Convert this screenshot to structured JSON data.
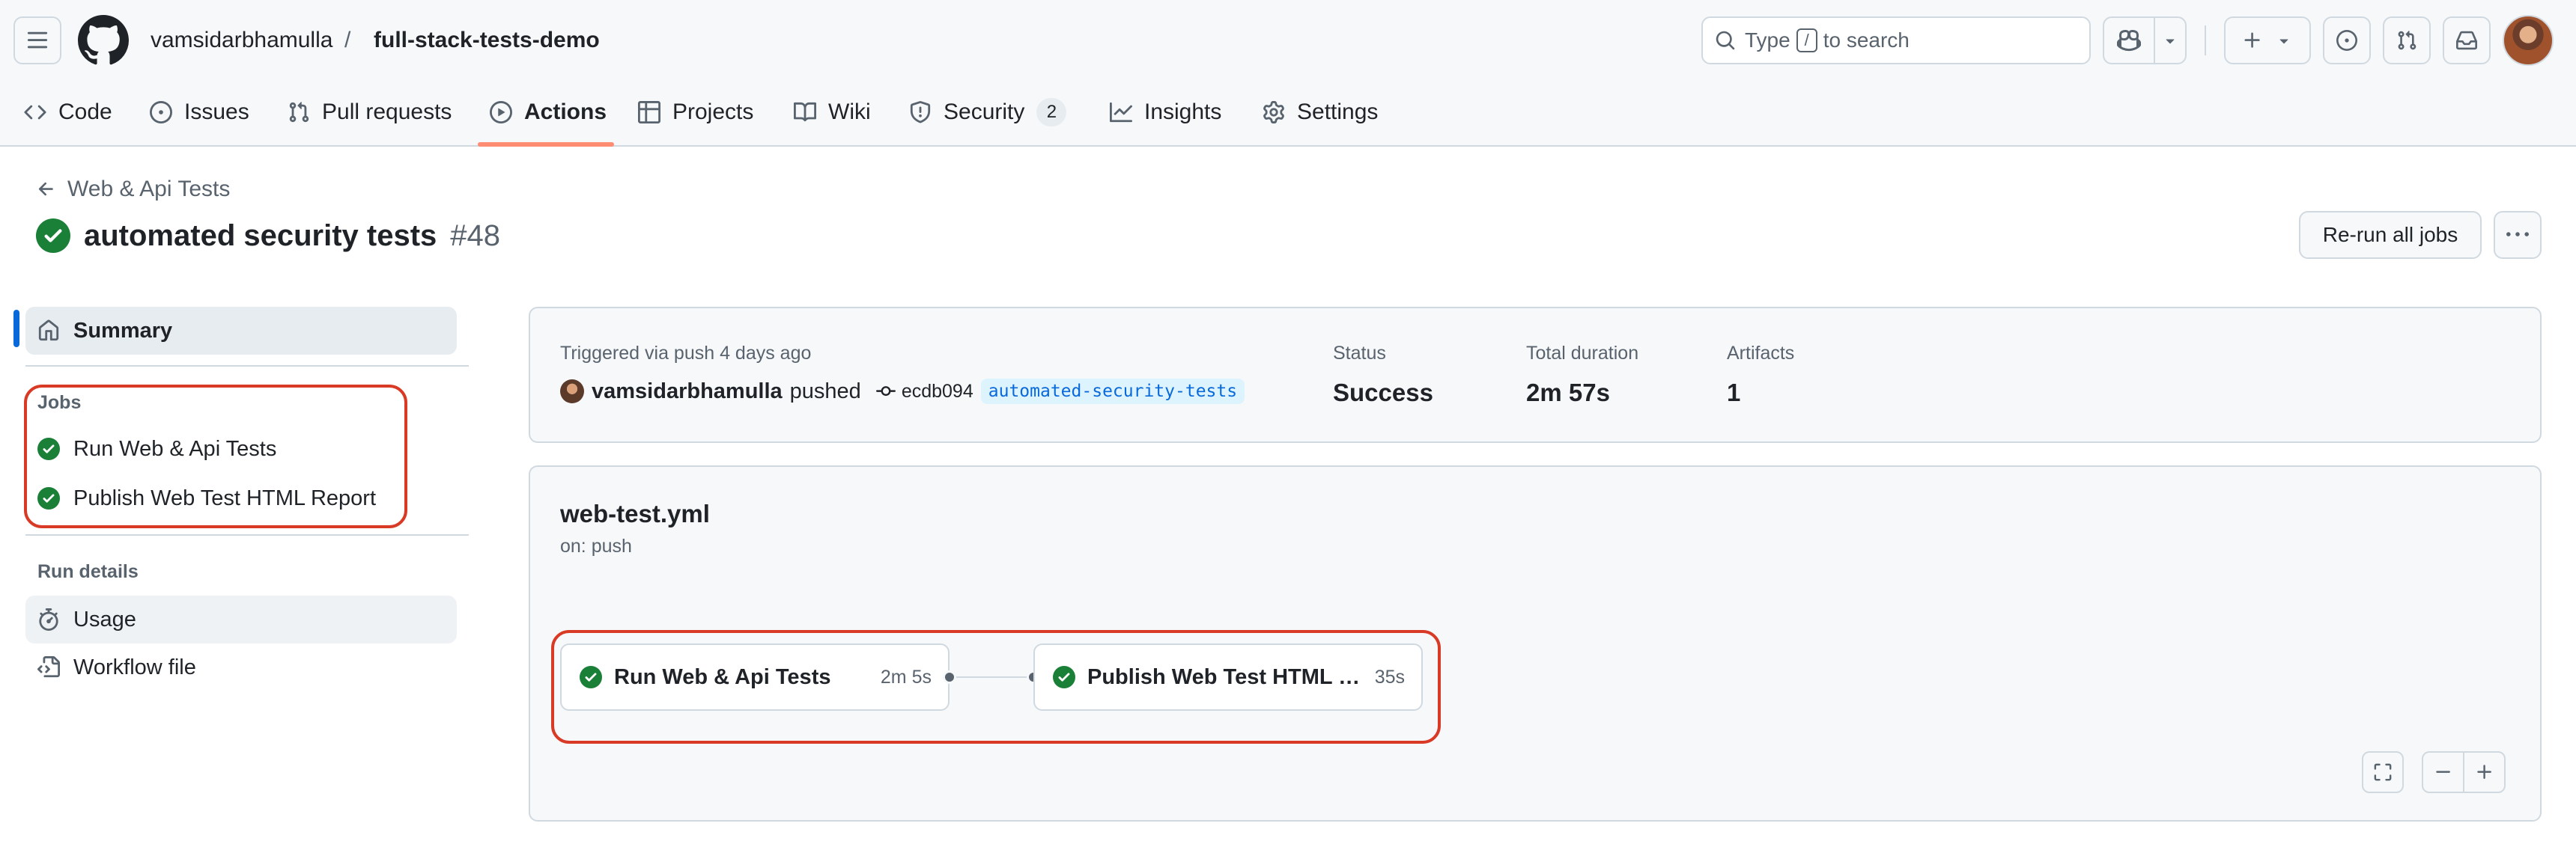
{
  "header": {
    "owner": "vamsidarbhamulla",
    "separator": "/",
    "repo": "full-stack-tests-demo",
    "search_prefix": "Type",
    "search_key": "/",
    "search_suffix": "to search"
  },
  "tabs": [
    {
      "label": "Code",
      "icon": "code-icon"
    },
    {
      "label": "Issues",
      "icon": "issue-opened-icon"
    },
    {
      "label": "Pull requests",
      "icon": "git-pull-request-icon"
    },
    {
      "label": "Actions",
      "icon": "play-icon",
      "active": true
    },
    {
      "label": "Projects",
      "icon": "table-icon"
    },
    {
      "label": "Wiki",
      "icon": "book-icon"
    },
    {
      "label": "Security",
      "icon": "shield-icon",
      "counter": "2"
    },
    {
      "label": "Insights",
      "icon": "graph-icon"
    },
    {
      "label": "Settings",
      "icon": "gear-icon"
    }
  ],
  "run": {
    "back_label": "Web & Api Tests",
    "title": "automated security tests",
    "number": "#48",
    "rerun_label": "Re-run all jobs"
  },
  "sidebar": {
    "summary_label": "Summary",
    "jobs_heading": "Jobs",
    "jobs": [
      "Run Web & Api Tests",
      "Publish Web Test HTML Report"
    ],
    "run_details_heading": "Run details",
    "usage_label": "Usage",
    "workflow_file_label": "Workflow file"
  },
  "summary": {
    "trigger_text": "Triggered via push 4 days ago",
    "actor": "vamsidarbhamulla",
    "action": "pushed",
    "commit": "ecdb094",
    "branch": "automated-security-tests",
    "status_label": "Status",
    "status_value": "Success",
    "duration_label": "Total duration",
    "duration_value": "2m 57s",
    "artifacts_label": "Artifacts",
    "artifacts_value": "1"
  },
  "workflow": {
    "file": "web-test.yml",
    "trigger": "on: push",
    "jobs": [
      {
        "name": "Run Web & Api Tests",
        "duration": "2m 5s"
      },
      {
        "name": "Publish Web Test HTML R...",
        "duration": "35s"
      }
    ]
  },
  "colors": {
    "accent": "#0969da",
    "success": "#1a7f37",
    "annotation": "#d93a26",
    "tab_underline": "#fd8c73"
  }
}
